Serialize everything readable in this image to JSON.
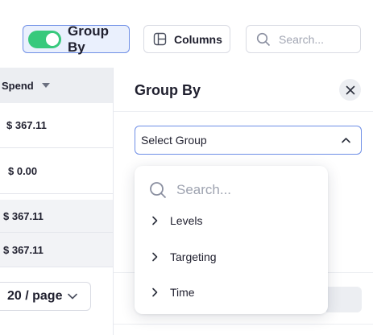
{
  "toolbar": {
    "group_by_label": "Group By",
    "columns_label": "Columns",
    "search_placeholder": "Search..."
  },
  "table": {
    "header": "Spend",
    "rows": [
      "$ 367.11",
      "$ 0.00",
      "$ 367.11",
      "$ 367.11"
    ]
  },
  "pagination": {
    "page_size_label": "20 / page"
  },
  "group_panel": {
    "title": "Group By",
    "select_placeholder": "Select Group",
    "dropdown": {
      "search_placeholder": "Search...",
      "items": [
        "Levels",
        "Targeting",
        "Time"
      ]
    }
  },
  "colors": {
    "accent": "#6f8fe6",
    "toggle_on": "#37c97c"
  },
  "icons": {
    "columns": "columns-icon",
    "search": "search-icon",
    "close": "close-icon",
    "chevron_up": "chevron-up-icon",
    "chevron_down": "chevron-down-icon",
    "chevron_right": "chevron-right-icon",
    "sort": "sort-caret-icon"
  }
}
